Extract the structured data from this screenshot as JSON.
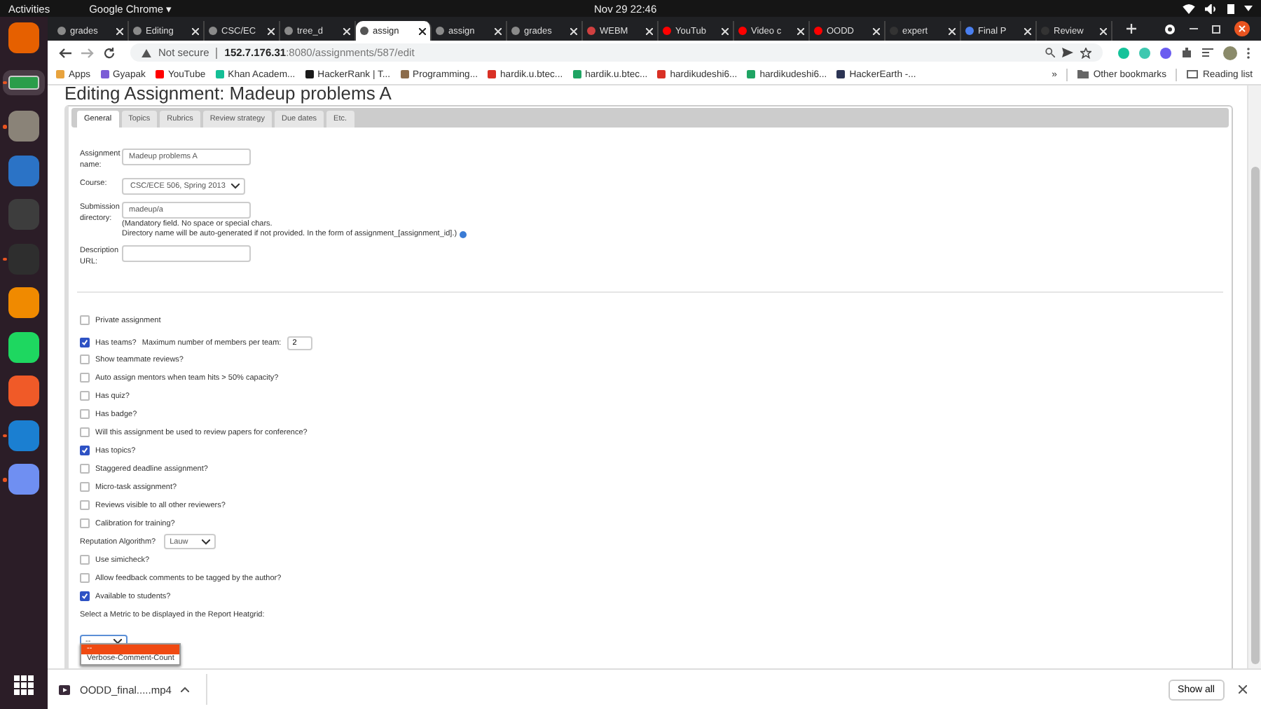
{
  "top_bar": {
    "activities": "Activities",
    "app_menu": "Google Chrome ▾",
    "clock": "Nov 29  22:46"
  },
  "dock": [
    {
      "kind": "firefox",
      "running": false,
      "selected": false
    },
    {
      "kind": "chrome",
      "running": true,
      "selected": true
    },
    {
      "kind": "files",
      "running": true,
      "selected": false
    },
    {
      "kind": "writer",
      "running": false,
      "selected": false
    },
    {
      "kind": "sublime",
      "running": false,
      "selected": false
    },
    {
      "kind": "terminal",
      "running": true,
      "selected": false
    },
    {
      "kind": "vlc",
      "running": false,
      "selected": false
    },
    {
      "kind": "spotify",
      "running": false,
      "selected": false
    },
    {
      "kind": "postman",
      "running": false,
      "selected": false
    },
    {
      "kind": "vscode",
      "running": true,
      "selected": false
    },
    {
      "kind": "screenshot",
      "running": true,
      "selected": false
    }
  ],
  "browser": {
    "tabs": [
      {
        "title": "grades",
        "selected": false
      },
      {
        "title": "Editing",
        "selected": false
      },
      {
        "title": "CSC/EC",
        "selected": false
      },
      {
        "title": "tree_d",
        "selected": false
      },
      {
        "title": "assign",
        "selected": true
      },
      {
        "title": "assign",
        "selected": false
      },
      {
        "title": "grades",
        "selected": false
      },
      {
        "title": "WEBM",
        "selected": false
      },
      {
        "title": "YouTub",
        "selected": false
      },
      {
        "title": "Video c",
        "selected": false
      },
      {
        "title": "OODD",
        "selected": false
      },
      {
        "title": "expert",
        "selected": false
      },
      {
        "title": "Final P",
        "selected": false
      },
      {
        "title": "Review",
        "selected": false
      }
    ],
    "security": "Not secure",
    "url_host": "152.7.176.31",
    "url_path": ":8080/assignments/587/edit",
    "bookmarks": [
      "Apps",
      "Gyapak",
      "YouTube",
      "Khan Academ...",
      "HackerRank | T...",
      "Programming...",
      "hardik.u.btec...",
      "hardik.u.btec...",
      "hardikudeshi6...",
      "hardikudeshi6...",
      "HackerEarth -..."
    ],
    "more_bookmarks": "»",
    "other_bookmarks": "Other bookmarks",
    "reading_list": "Reading list"
  },
  "page": {
    "title": "Editing Assignment: Madeup problems A",
    "tabs": [
      {
        "label": "General",
        "selected": true
      },
      {
        "label": "Topics",
        "selected": false
      },
      {
        "label": "Rubrics",
        "selected": false
      },
      {
        "label": "Review strategy",
        "selected": false
      },
      {
        "label": "Due dates",
        "selected": false
      },
      {
        "label": "Etc.",
        "selected": false
      }
    ],
    "fields": [
      {
        "kind": "input",
        "label": "Assignment name:",
        "value": "Madeup problems A"
      },
      {
        "kind": "select",
        "label": "Course:",
        "value": "CSC/ECE 506, Spring 2013"
      },
      {
        "kind": "input",
        "label": "Submission directory:",
        "value": "madeup/a",
        "help": [
          "(Mandatory field. No space or special chars.",
          "Directory name will be auto-generated if not provided. In the form of assignment_[assignment_id].)"
        ]
      },
      {
        "kind": "input",
        "label": "Description URL:"
      }
    ],
    "options": [
      {
        "kind": "checkbox",
        "label": "Private assignment",
        "checked": false
      },
      {
        "kind": "gap"
      },
      {
        "kind": "team",
        "label": "Has teams?",
        "checked": true,
        "extra_label": "Maximum number of members per team:",
        "value": "2"
      },
      {
        "kind": "checkbox",
        "label": "Show teammate reviews?",
        "checked": false
      },
      {
        "kind": "checkbox",
        "label": "Auto assign mentors when team hits > 50% capacity?",
        "checked": false
      },
      {
        "kind": "checkbox",
        "label": "Has quiz?",
        "checked": false
      },
      {
        "kind": "checkbox",
        "label": "Has badge?",
        "checked": false
      },
      {
        "kind": "checkbox",
        "label": "Will this assignment be used to review papers for conference?",
        "checked": false
      },
      {
        "kind": "checkbox",
        "label": "Has topics?",
        "checked": true
      },
      {
        "kind": "checkbox",
        "label": "Staggered deadline assignment?",
        "checked": false
      },
      {
        "kind": "checkbox",
        "label": "Micro-task assignment?",
        "checked": false
      },
      {
        "kind": "checkbox",
        "label": "Reviews visible to all other reviewers?",
        "checked": false
      },
      {
        "kind": "checkbox",
        "label": "Calibration for training?",
        "checked": false
      },
      {
        "kind": "select",
        "label": "Reputation Algorithm?",
        "value": "Lauw"
      },
      {
        "kind": "checkbox",
        "label": "Use simicheck?",
        "checked": false
      },
      {
        "kind": "checkbox",
        "label": "Allow feedback comments to be tagged by the author?",
        "checked": false
      },
      {
        "kind": "checkbox",
        "label": "Available to students?",
        "checked": true
      },
      {
        "kind": "text",
        "label": "Select a Metric to be displayed in the Report Heatgrid:"
      }
    ],
    "metric": {
      "value": "--",
      "options": [
        {
          "label": "--",
          "selected": true
        },
        {
          "label": "Verbose-Comment-Count",
          "selected": false
        }
      ]
    }
  },
  "downloads": {
    "file": "OODD_final.....mp4",
    "show_all": "Show all"
  }
}
